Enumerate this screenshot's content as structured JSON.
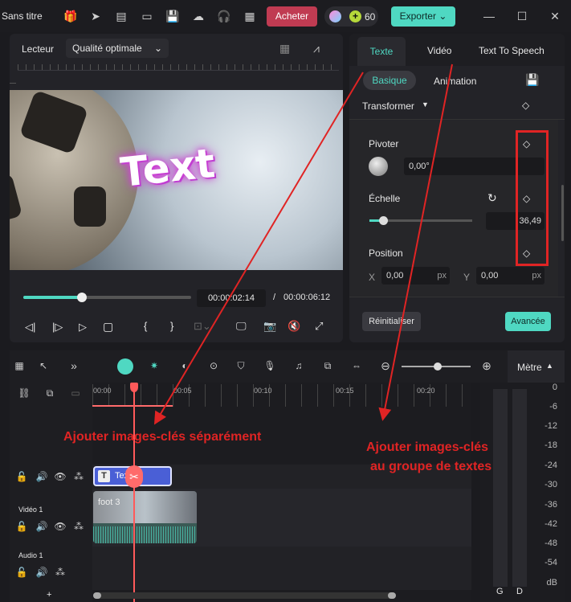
{
  "app": {
    "title": "Sans titre",
    "buy_label": "Acheter",
    "credits": "60",
    "export_label": "Exporter"
  },
  "player": {
    "label": "Lecteur",
    "quality": "Qualité optimale",
    "overlay_text": "Text",
    "current_time": "00:00:02:14",
    "separator": "/",
    "total_time": "00:00:06:12",
    "progress": 0.35
  },
  "props": {
    "tabs": [
      "Texte",
      "Vidéo",
      "Text To Speech"
    ],
    "subtabs": [
      "Basique",
      "Animation"
    ],
    "section": "Transformer",
    "rotate_label": "Pivoter",
    "rotate_value": "0,00°",
    "scale_label": "Échelle",
    "scale_value": "36,49",
    "position_label": "Position",
    "x_label": "X",
    "x_value": "0,00",
    "x_unit": "px",
    "y_label": "Y",
    "y_value": "0,00",
    "y_unit": "px",
    "reset_label": "Réinitialiser",
    "advanced_label": "Avancée"
  },
  "timeline": {
    "meter_label": "Mètre",
    "ruler": [
      "00:00",
      "00:05",
      "00:10",
      "00:15",
      "00:20"
    ],
    "db_scale": [
      "0",
      "-6",
      "-12",
      "-18",
      "-24",
      "-30",
      "-36",
      "-42",
      "-48",
      "-54",
      "dB"
    ],
    "meter_channels": [
      "G",
      "D"
    ],
    "text_clip": "Text",
    "video_clip": "foot 3",
    "track_video": "Vidéo 1",
    "track_audio": "Audio 1"
  },
  "annotations": {
    "left": "Ajouter images-clés séparément",
    "right_line1": "Ajouter images-clés",
    "right_line2": "au groupe de textes"
  },
  "colors": {
    "accent": "#4fd8c2",
    "buy": "#c03b52",
    "annotation": "#e02424",
    "playhead": "#ff5a5a",
    "clip_text": "#4a5fd6"
  }
}
